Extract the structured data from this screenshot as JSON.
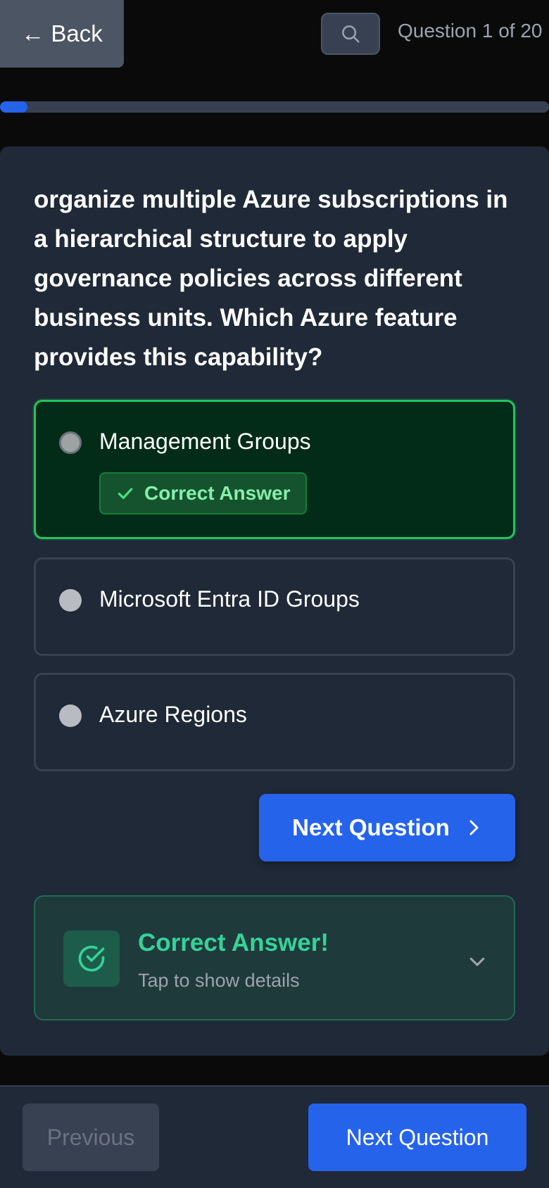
{
  "header": {
    "back_label": "← Back",
    "counter": "Question 1 of 20",
    "progress_fraction": 0.05,
    "search_icon": "search-icon"
  },
  "question": {
    "text": "organize multiple Azure subscriptions in a hierarchical structure to apply governance policies across different business units. Which Azure feature provides this capability?"
  },
  "options": [
    {
      "label": "Management Groups",
      "state": "correct",
      "badge": "Correct Answer"
    },
    {
      "label": "Microsoft Entra ID Groups",
      "state": "default"
    },
    {
      "label": "Azure Regions",
      "state": "default"
    }
  ],
  "next_inline": {
    "label": "Next Question",
    "icon": "chevron-right-icon"
  },
  "feedback": {
    "title": "Correct Answer!",
    "subtitle": "Tap to show details",
    "icon": "check-circle-icon",
    "toggle_icon": "chevron-down-icon"
  },
  "footer": {
    "previous_label": "Previous",
    "next_label": "Next Question"
  },
  "colors": {
    "accent": "#2563eb",
    "correct_border": "#22c55e",
    "correct_text": "#34d399",
    "background": "#0a0a0b",
    "card": "#1f2937"
  }
}
